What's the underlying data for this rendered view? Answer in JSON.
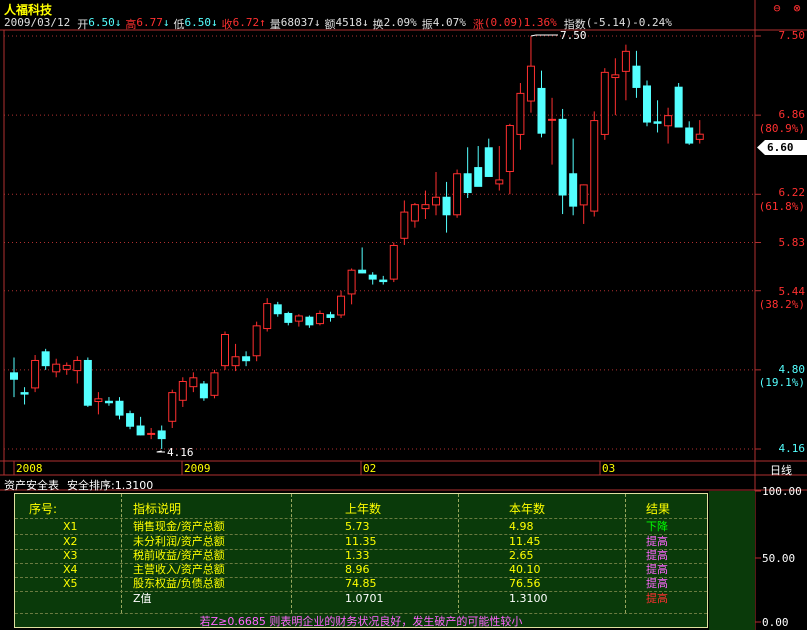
{
  "stock": {
    "name": "人福科技"
  },
  "quote": {
    "date": "2009/03/12",
    "open_label": "开",
    "open": "6.50",
    "high_label": "高",
    "high": "6.77",
    "low_label": "低",
    "low": "6.50",
    "close_label": "收",
    "close": "6.72",
    "volume_label": "量",
    "volume": "68037",
    "amount_label": "额",
    "amount": "4518",
    "turnover_label": "换",
    "turnover": "2.09%",
    "amplitude_label": "振",
    "amplitude": "4.07%",
    "change_label": "涨",
    "change": "(0.09)",
    "change_pct": "1.36%",
    "index_label": "指数",
    "index": "(-5.14)-0.24%"
  },
  "corner_buttons": {
    "restore": "⊖",
    "close": "⊗"
  },
  "price_axis": {
    "labels": [
      "7.50",
      "6.86",
      "(80.9%)",
      "6.22",
      "(61.8%)",
      "5.83",
      "5.44",
      "(38.2%)",
      "4.80",
      "(19.1%)",
      "4.16"
    ],
    "current_price": "6.60"
  },
  "annotations": {
    "high_mark": "7.50",
    "low_mark": "4.16"
  },
  "time_axis": {
    "labels": [
      "2008",
      "2009",
      "02",
      "03"
    ],
    "period": "日线"
  },
  "panel": {
    "title": "资产安全表",
    "subtitle": "安全排序:1.3100",
    "scale": [
      "100.00",
      "50.00",
      "0.00"
    ]
  },
  "zscore_table": {
    "headers": {
      "idx": "序号:",
      "desc": "指标说明",
      "prev": "上年数",
      "cur": "本年数",
      "result": "结果"
    },
    "rows": [
      {
        "idx": "X1",
        "desc": "销售现金/资产总额",
        "prev": "5.73",
        "cur": "4.98",
        "result": "下降",
        "result_color": "#00ff00"
      },
      {
        "idx": "X2",
        "desc": "未分利润/资产总额",
        "prev": "11.35",
        "cur": "11.45",
        "result": "提高",
        "result_color": "#ff66ff"
      },
      {
        "idx": "X3",
        "desc": "税前收益/资产总额",
        "prev": "1.33",
        "cur": "2.65",
        "result": "提高",
        "result_color": "#ff66ff"
      },
      {
        "idx": "X4",
        "desc": "主营收入/资产总额",
        "prev": "8.96",
        "cur": "40.10",
        "result": "提高",
        "result_color": "#ff66ff"
      },
      {
        "idx": "X5",
        "desc": "股东权益/负债总额",
        "prev": "74.85",
        "cur": "76.56",
        "result": "提高",
        "result_color": "#ff66ff"
      },
      {
        "idx": "",
        "desc": "Z值",
        "prev": "1.0701",
        "cur": "1.3100",
        "result": "提高",
        "result_color": "#ff3030"
      }
    ],
    "note": "若Z≥0.6685 则表明企业的财务状况良好，发生破产的可能性较小"
  },
  "colors": {
    "up": "#ff3030",
    "down": "#54ffff",
    "axis": "#b03030",
    "grid": "#b03030"
  },
  "chart_data": {
    "type": "candlestick",
    "price_range": [
      4.16,
      7.5
    ],
    "fib_levels": [
      {
        "price": 6.86,
        "pct": "80.9%"
      },
      {
        "price": 6.22,
        "pct": "61.8%"
      },
      {
        "price": 5.44,
        "pct": "38.2%"
      },
      {
        "price": 4.8,
        "pct": "19.1%"
      }
    ],
    "candles": [
      [
        4.78,
        4.9,
        4.58,
        4.72
      ],
      [
        4.62,
        4.66,
        4.52,
        4.6
      ],
      [
        4.65,
        4.92,
        4.62,
        4.88
      ],
      [
        4.95,
        4.97,
        4.8,
        4.83
      ],
      [
        4.78,
        4.89,
        4.74,
        4.85
      ],
      [
        4.8,
        4.86,
        4.76,
        4.84
      ],
      [
        4.79,
        4.91,
        4.69,
        4.88
      ],
      [
        4.88,
        4.9,
        4.5,
        4.51
      ],
      [
        4.54,
        4.62,
        4.44,
        4.57
      ],
      [
        4.55,
        4.58,
        4.51,
        4.53
      ],
      [
        4.55,
        4.58,
        4.4,
        4.43
      ],
      [
        4.45,
        4.47,
        4.32,
        4.34
      ],
      [
        4.35,
        4.42,
        4.27,
        4.27
      ],
      [
        4.28,
        4.33,
        4.24,
        4.29
      ],
      [
        4.31,
        4.35,
        4.16,
        4.24
      ],
      [
        4.38,
        4.64,
        4.33,
        4.62
      ],
      [
        4.55,
        4.74,
        4.5,
        4.71
      ],
      [
        4.66,
        4.78,
        4.62,
        4.74
      ],
      [
        4.69,
        4.71,
        4.55,
        4.57
      ],
      [
        4.59,
        4.8,
        4.57,
        4.78
      ],
      [
        4.83,
        5.11,
        4.8,
        5.09
      ],
      [
        4.83,
        5.01,
        4.79,
        4.91
      ],
      [
        4.91,
        4.95,
        4.83,
        4.87
      ],
      [
        4.91,
        5.19,
        4.87,
        5.16
      ],
      [
        5.13,
        5.38,
        5.11,
        5.34
      ],
      [
        5.33,
        5.35,
        5.23,
        5.25
      ],
      [
        5.26,
        5.27,
        5.16,
        5.18
      ],
      [
        5.19,
        5.25,
        5.15,
        5.24
      ],
      [
        5.23,
        5.24,
        5.14,
        5.16
      ],
      [
        5.17,
        5.28,
        5.16,
        5.26
      ],
      [
        5.25,
        5.27,
        5.19,
        5.22
      ],
      [
        5.24,
        5.44,
        5.22,
        5.4
      ],
      [
        5.41,
        5.62,
        5.33,
        5.61
      ],
      [
        5.61,
        5.79,
        5.58,
        5.58
      ],
      [
        5.57,
        5.59,
        5.49,
        5.53
      ],
      [
        5.53,
        5.56,
        5.49,
        5.51
      ],
      [
        5.53,
        5.83,
        5.51,
        5.81
      ],
      [
        5.86,
        6.17,
        5.81,
        6.08
      ],
      [
        6.0,
        6.15,
        5.95,
        6.14
      ],
      [
        6.1,
        6.25,
        6.02,
        6.14
      ],
      [
        6.13,
        6.4,
        6.05,
        6.2
      ],
      [
        6.2,
        6.32,
        5.91,
        6.05
      ],
      [
        6.05,
        6.42,
        6.03,
        6.39
      ],
      [
        6.39,
        6.6,
        6.19,
        6.23
      ],
      [
        6.44,
        6.61,
        6.32,
        6.28
      ],
      [
        6.6,
        6.67,
        6.36,
        6.36
      ],
      [
        6.3,
        6.61,
        6.25,
        6.34
      ],
      [
        6.4,
        6.79,
        6.22,
        6.78
      ],
      [
        6.7,
        7.12,
        6.58,
        7.04
      ],
      [
        6.97,
        7.5,
        6.88,
        7.26
      ],
      [
        7.08,
        7.22,
        6.68,
        6.71
      ],
      [
        6.83,
        7.0,
        6.46,
        6.83
      ],
      [
        6.83,
        6.91,
        6.06,
        6.21
      ],
      [
        6.39,
        6.67,
        6.05,
        6.12
      ],
      [
        6.13,
        6.3,
        5.98,
        6.3
      ],
      [
        6.08,
        6.89,
        6.04,
        6.82
      ],
      [
        6.7,
        7.24,
        6.66,
        7.21
      ],
      [
        7.16,
        7.32,
        6.86,
        7.19
      ],
      [
        7.21,
        7.43,
        6.98,
        7.38
      ],
      [
        7.26,
        7.38,
        7.0,
        7.08
      ],
      [
        7.1,
        7.14,
        6.77,
        6.8
      ],
      [
        6.81,
        6.98,
        6.72,
        6.79
      ],
      [
        6.77,
        6.92,
        6.63,
        6.86
      ],
      [
        7.09,
        7.12,
        6.8,
        6.76
      ],
      [
        6.76,
        6.81,
        6.62,
        6.63
      ],
      [
        6.66,
        6.82,
        6.63,
        6.71
      ]
    ]
  }
}
